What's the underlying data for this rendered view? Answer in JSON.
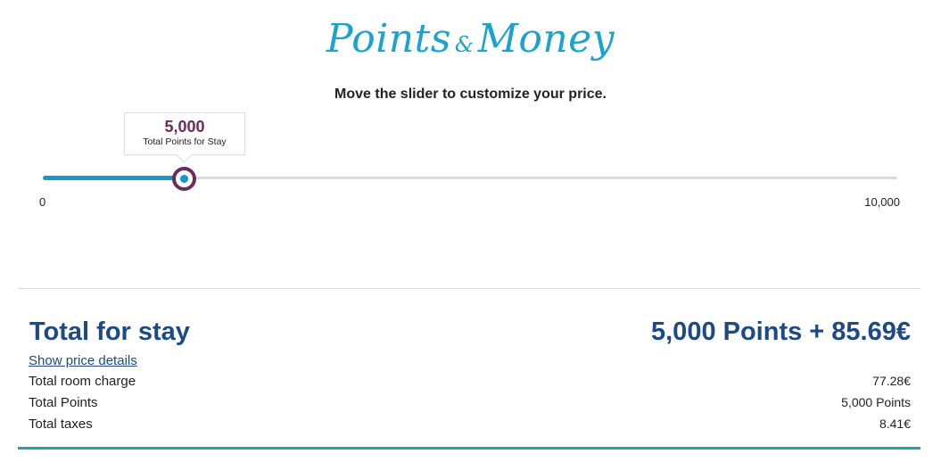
{
  "logo": {
    "part1": "Points",
    "amp": "&",
    "part2": "Money"
  },
  "subtitle": "Move the slider to customize your price.",
  "slider": {
    "tooltip_value": "5,000",
    "tooltip_label": "Total Points for Stay",
    "min_label": "0",
    "max_label": "10,000",
    "min": 0,
    "max": 10000,
    "value": 1650
  },
  "summary": {
    "title": "Total for stay",
    "total_value": "5,000 Points + 85.69€",
    "show_details": "Show price details",
    "rows": [
      {
        "label": "Total room charge",
        "value": "77.28€"
      },
      {
        "label": "Total Points",
        "value": "5,000 Points"
      },
      {
        "label": "Total taxes",
        "value": "8.41€"
      }
    ]
  },
  "colors": {
    "accent_blue": "#1a95c8",
    "handle_purple": "#6b2c5c",
    "heading_navy": "#1d4a85",
    "bottom_bar": "#1aa3b8"
  }
}
